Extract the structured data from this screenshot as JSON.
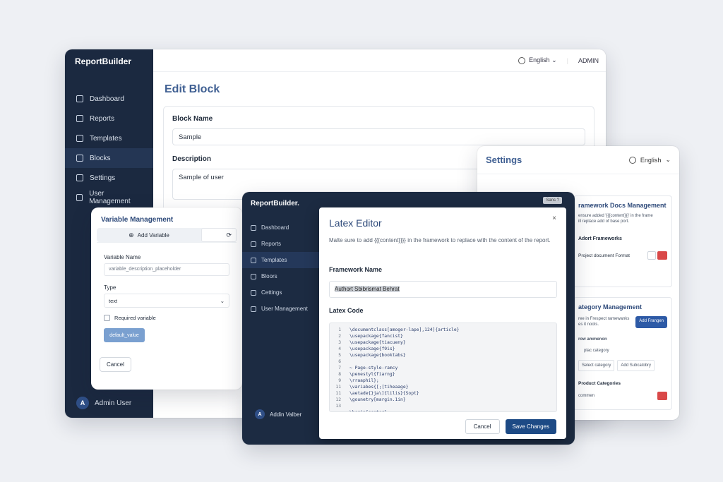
{
  "back_window": {
    "brand": "ReportBuilder",
    "nav": [
      "Dashboard",
      "Reports",
      "Templates",
      "Blocks",
      "Settings",
      "User Management"
    ],
    "active_nav": 3,
    "topbar": {
      "language": "English",
      "user": "ADMIN"
    },
    "title": "Edit Block",
    "block_name_label": "Block Name",
    "block_name_value": "Sample",
    "description_label": "Description",
    "description_value": "Sample of user",
    "footer_user": "Admin User",
    "avatar_letter": "A"
  },
  "settings_window": {
    "title": "Settings",
    "language": "English",
    "framework_docs": "ramework Docs Management",
    "framework_note_1": "ensure added '{{{content}}}' in the frame",
    "framework_note_2": "ill replace add of base port.",
    "adopt_frameworks": "Adort Frameworks",
    "project_document_format": "Project document Format",
    "category_management": "ategory Management",
    "category_note_1": "ree in Frespect ramewanks",
    "category_note_2": "es it noots.",
    "add_framework_button": "Add Frangen",
    "subsection_1": "row ammenon",
    "subsection_2": "plac category",
    "select_category": "Select category",
    "add_subcategory": "Add Subcatobry",
    "product_categories": "Product Categories",
    "item_name": "commen"
  },
  "variable_window": {
    "title": "Variable Management",
    "add_variable": "Add Variable",
    "variable_name_label": "Variable Name",
    "variable_name_placeholder": "variable_description_placeholder",
    "type_label": "Type",
    "type_value": "text",
    "required_label": "Required variable",
    "default_value_button": "default_value",
    "cancel": "Cancel"
  },
  "front_window": {
    "brand": "ReportBuilder.",
    "nav": [
      "Dashboard",
      "Reports",
      "Templates",
      "Bloors",
      "Cettings",
      "User Management"
    ],
    "active_nav": 2,
    "top_chip": "Sans   ?",
    "footer_user": "Addin Valber",
    "avatar_letter": "A"
  },
  "latex_dialog": {
    "title": "Latex Editor",
    "close": "×",
    "note": "Malte sure to add {{{content}}}} in the framework to replace with the content of the report.",
    "framework_name_label": "Framework Name",
    "framework_name_value": "Authort Sbibrismat Behrat",
    "latex_code_label": "Latex Code",
    "code_lines": [
      {
        "n": "1",
        "text": "\\documentclass[amoger-lape],124]{article}"
      },
      {
        "n": "2",
        "text": "\\usepackage{fancist}"
      },
      {
        "n": "3",
        "text": "\\usepackage{tiacueny}"
      },
      {
        "n": "4",
        "text": "\\usepackage{f9is}"
      },
      {
        "n": "5",
        "text": "\\usepackage{booktabs}"
      },
      {
        "n": "6",
        "text": ""
      },
      {
        "n": "7",
        "text": "~ Page-style-ramcy"
      },
      {
        "n": "8",
        "text": "\\penestyl{fiarng}"
      },
      {
        "n": "9",
        "text": "\\rraaphil};"
      },
      {
        "n": "11",
        "text": "\\variabes{[;[tiheaage}"
      },
      {
        "n": "11",
        "text": "\\aetade{}ja\\]{lilis}{Sopt}"
      },
      {
        "n": "12",
        "text": "\\gounetry[margin.1in}"
      },
      {
        "n": "13",
        "text": ""
      },
      {
        "n": "",
        "text": "\\begin{center}"
      }
    ],
    "cancel": "Cancel",
    "save": "Save Changes"
  }
}
